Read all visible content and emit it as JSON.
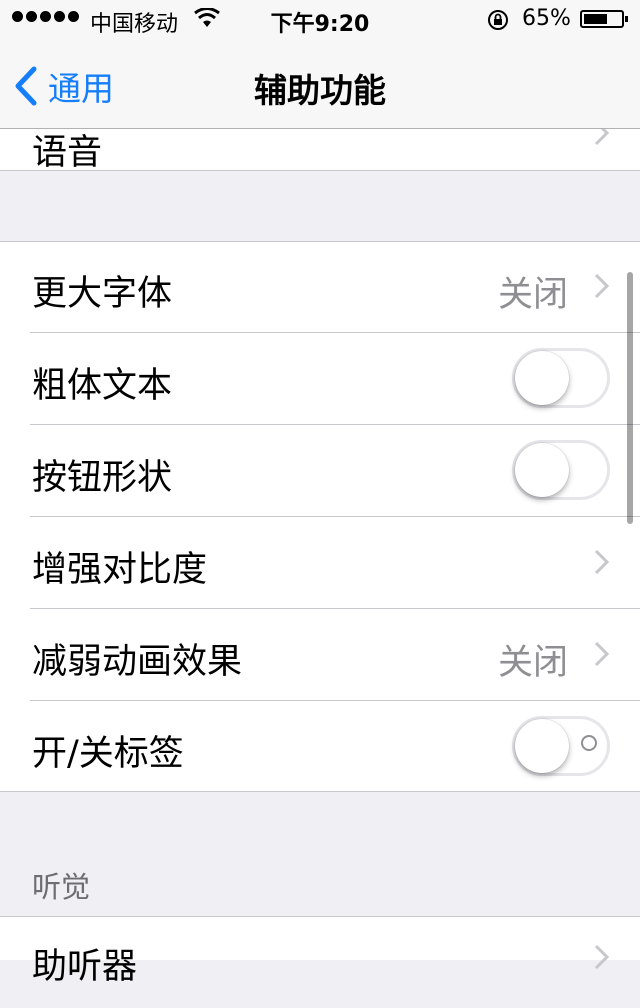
{
  "status_bar": {
    "carrier": "中国移动",
    "time": "下午9:20",
    "battery_percent": "65%",
    "battery_level": 0.65,
    "icons": [
      "signal-dots-icon",
      "wifi-icon",
      "rotation-lock-icon",
      "battery-icon"
    ]
  },
  "nav": {
    "back_label": "通用",
    "title": "辅助功能"
  },
  "top_partial_row": {
    "label": "语音"
  },
  "group1": {
    "rows": [
      {
        "label": "更大字体",
        "value": "关闭",
        "control": "chevron"
      },
      {
        "label": "粗体文本",
        "control": "toggle",
        "state": "off"
      },
      {
        "label": "按钮形状",
        "control": "toggle",
        "state": "off"
      },
      {
        "label": "增强对比度",
        "control": "chevron"
      },
      {
        "label": "减弱动画效果",
        "value": "关闭",
        "control": "chevron"
      },
      {
        "label": "开/关标签",
        "control": "toggle",
        "state": "off"
      }
    ]
  },
  "hearing_section": {
    "header": "听觉",
    "rows": [
      {
        "label": "助听器",
        "control": "chevron"
      }
    ]
  },
  "colors": {
    "accent": "#157efb",
    "background": "#efeff4",
    "separator": "#c8c7cc",
    "secondary_text": "#8e8e93"
  }
}
